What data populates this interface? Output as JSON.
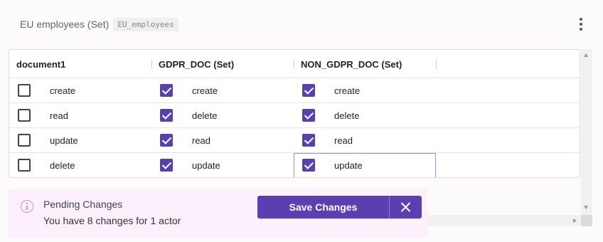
{
  "header": {
    "title": "EU employees (Set)",
    "code": "EU_employees"
  },
  "grid": {
    "columns": [
      "document1",
      "GDPR_DOC (Set)",
      "NON_GDPR_DOC (Set)"
    ],
    "rows": [
      {
        "cells": [
          {
            "label": "create",
            "checked": false
          },
          {
            "label": "create",
            "checked": true
          },
          {
            "label": "create",
            "checked": true
          }
        ]
      },
      {
        "cells": [
          {
            "label": "read",
            "checked": false
          },
          {
            "label": "delete",
            "checked": true
          },
          {
            "label": "delete",
            "checked": true
          }
        ]
      },
      {
        "cells": [
          {
            "label": "update",
            "checked": false
          },
          {
            "label": "read",
            "checked": true
          },
          {
            "label": "read",
            "checked": true
          }
        ]
      },
      {
        "cells": [
          {
            "label": "delete",
            "checked": false
          },
          {
            "label": "update",
            "checked": true
          },
          {
            "label": "update",
            "checked": true
          }
        ]
      }
    ]
  },
  "pending": {
    "title": "Pending Changes",
    "message": "You have 8 changes for 1 actor"
  },
  "actions": {
    "save_label": "Save Changes"
  },
  "colors": {
    "accent": "#5940b0",
    "pending_bg": "#fcf0fc"
  },
  "icons": [
    "more-vertical-icon",
    "info-icon",
    "close-icon",
    "checkbox-checked-icon",
    "checkbox-unchecked-icon"
  ]
}
